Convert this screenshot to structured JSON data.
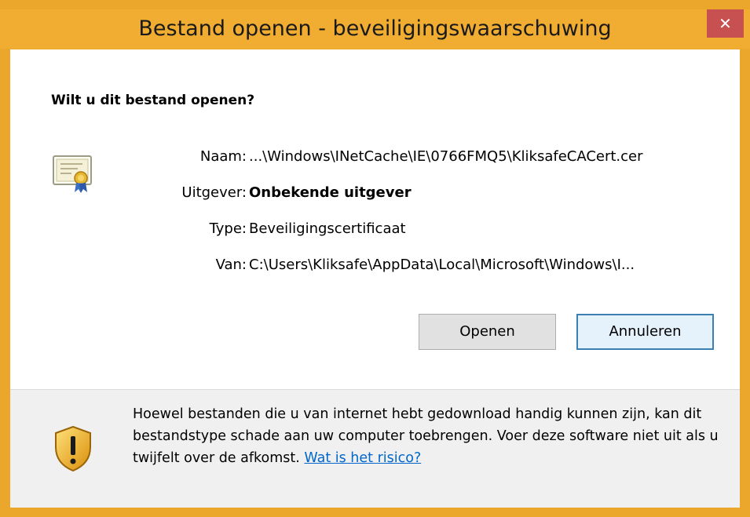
{
  "window": {
    "title": "Bestand openen - beveiligingswaarschuwing",
    "close_glyph": "✕"
  },
  "dialog": {
    "question": "Wilt u dit bestand openen?",
    "fields": {
      "name_label": "Naam:",
      "name_value": "...\\Windows\\INetCache\\IE\\0766FMQ5\\KliksafeCACert.cer",
      "publisher_label": "Uitgever:",
      "publisher_value": "Onbekende uitgever",
      "type_label": "Type:",
      "type_value": "Beveiligingscertificaat",
      "from_label": "Van:",
      "from_value": "C:\\Users\\Kliksafe\\AppData\\Local\\Microsoft\\Windows\\I..."
    },
    "buttons": {
      "open_label": "Openen",
      "cancel_label": "Annuleren"
    }
  },
  "footer": {
    "warning_text": "Hoewel bestanden die u van internet hebt gedownload handig kunnen zijn, kan dit bestandstype schade aan uw computer toebrengen. Voer deze software niet uit als u twijfelt over de afkomst.",
    "risk_link": "Wat is het risico?"
  },
  "icons": {
    "certificate": "certificate-icon",
    "shield": "shield-warning-icon",
    "close": "close-icon"
  },
  "colors": {
    "frame": "#f1ad32",
    "close_button": "#c75050",
    "link": "#0066cc",
    "default_button_border": "#3c7fb1"
  }
}
